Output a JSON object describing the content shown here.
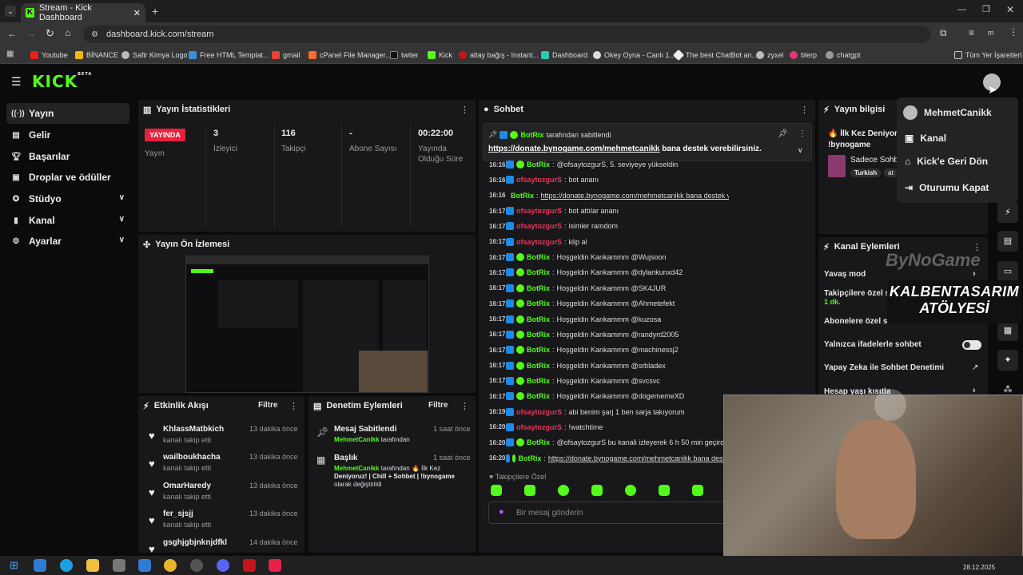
{
  "browser": {
    "tab_title": "Stream - Kick Dashboard",
    "url": "dashboard.kick.com/stream",
    "bookmarks": [
      "Youtube",
      "BİNANCE",
      "Safir Kimya Logo",
      "Free HTML Templat...",
      "gmail",
      "cPanel File Manager...",
      "twiter",
      "Kick",
      "altay bağış - Instant...",
      "Dashboard",
      "Okey Oyna - Canlı 1...",
      "The best ChatBot an...",
      "zyxel",
      "blerp",
      "chatgpt"
    ],
    "all_bookmarks": "Tüm Yer İşaretleri",
    "profile_initial": "m"
  },
  "header": {
    "logo": "KICK",
    "beta": "BETA"
  },
  "sidebar": {
    "items": [
      {
        "label": "Yayın"
      },
      {
        "label": "Gelir"
      },
      {
        "label": "Başarılar"
      },
      {
        "label": "Droplar ve ödüller"
      },
      {
        "label": "Stüdyo"
      },
      {
        "label": "Kanal"
      },
      {
        "label": "Ayarlar"
      }
    ]
  },
  "stats": {
    "title": "Yayın İstatistikleri",
    "live_badge": "YAYINDA",
    "live_label": "Yayın",
    "viewers_value": "3",
    "viewers_label": "İzleyici",
    "followers_value": "116",
    "followers_label": "Takipçi",
    "subs_value": "-",
    "subs_label": "Abone Sayısı",
    "duration_value": "00:22:00",
    "duration_label_1": "Yayında",
    "duration_label_2": "Olduğu Süre"
  },
  "preview": {
    "title": "Yayın Ön İzlemesi"
  },
  "activity": {
    "title": "Etkinlik Akışı",
    "filter": "Filtre",
    "events": [
      {
        "name": "KhlassMatbkich",
        "sub": "kanalı takip etti",
        "time": "13 dakika önce"
      },
      {
        "name": "wailboukhacha",
        "sub": "kanalı takip etti",
        "time": "13 dakika önce"
      },
      {
        "name": "OmarHaredy",
        "sub": "kanalı takip etti",
        "time": "13 dakika önce"
      },
      {
        "name": "fer_sjsjj",
        "sub": "kanalı takip etti",
        "time": "13 dakika önce"
      },
      {
        "name": "gsghjgbjnknjdfkl",
        "sub": "",
        "time": "14 dakika önce"
      }
    ]
  },
  "mod": {
    "title": "Denetim Eylemleri",
    "filter": "Filtre",
    "a1_title": "Mesaj Sabitlendi",
    "a1_user": "MehmetCanikk",
    "a1_rest": "tarafından",
    "a1_time": "1 saat önce",
    "a2_title": "Başlık",
    "a2_user": "MehmetCanikk",
    "a2_rest": "tarafından 🔥 İlk Kez",
    "a2_line2": "Deniyoruz! | Chill + Sohbet | !bynogame",
    "a2_line3": "olarak değiştirildi",
    "a2_time": "1 saat önce"
  },
  "chat": {
    "title": "Sohbet",
    "pinned_by_user": "BotRix",
    "pinned_by_rest": "tarafından sabitlendi",
    "pinned_link": "https://donate.bynogame.com/mehmetcanikk",
    "pinned_rest": "bana destek verebilirsiniz.",
    "messages": [
      {
        "time": "16:16",
        "user": "BotRix",
        "text": "@ofsaytozgurS, 5. seviyeye yükseldin",
        "color": "#53fc18",
        "bot": true
      },
      {
        "time": "16:16",
        "user": "ofsaytozgurS",
        "text": "bot ananı",
        "color": "#e8345a",
        "bot": false
      },
      {
        "time": "16:16",
        "user": "BotRix",
        "text": "https://donate.bynogame.com/mehmetcanikk bana destek verebilirsiniz.",
        "color": "#53fc18",
        "bot": true
      },
      {
        "time": "16:17",
        "user": "ofsaytozgurS",
        "text": "bot attılar ananı",
        "color": "#e8345a",
        "bot": false
      },
      {
        "time": "16:17",
        "user": "ofsaytozgurS",
        "text": "isimler ramdom",
        "color": "#e8345a",
        "bot": false
      },
      {
        "time": "16:17",
        "user": "ofsaytozgurS",
        "text": "klip al",
        "color": "#e8345a",
        "bot": false
      },
      {
        "time": "16:17",
        "user": "BotRix",
        "text": "Hoşgeldin Kankammm @Wujsoon",
        "color": "#53fc18",
        "bot": true
      },
      {
        "time": "16:17",
        "user": "BotRix",
        "text": "Hoşgeldin Kankammm @dylankunxd42",
        "color": "#53fc18",
        "bot": true
      },
      {
        "time": "16:17",
        "user": "BotRix",
        "text": "Hoşgeldin Kankammm @SK4JUR",
        "color": "#53fc18",
        "bot": true
      },
      {
        "time": "16:17",
        "user": "BotRix",
        "text": "Hoşgeldin Kankammm @Ahmetefekt",
        "color": "#53fc18",
        "bot": true
      },
      {
        "time": "16:17",
        "user": "BotRix",
        "text": "Hoşgeldin Kankammm @kuzosa",
        "color": "#53fc18",
        "bot": true
      },
      {
        "time": "16:17",
        "user": "BotRix",
        "text": "Hoşgeldin Kankammm @randyrd2005",
        "color": "#53fc18",
        "bot": true
      },
      {
        "time": "16:17",
        "user": "BotRix",
        "text": "Hoşgeldin Kankammm @machinessj2",
        "color": "#53fc18",
        "bot": true
      },
      {
        "time": "16:17",
        "user": "BotRix",
        "text": "Hoşgeldin Kankammm @srbladex",
        "color": "#53fc18",
        "bot": true
      },
      {
        "time": "16:17",
        "user": "BotRix",
        "text": "Hoşgeldin Kankammm @svcsvc",
        "color": "#53fc18",
        "bot": true
      },
      {
        "time": "16:17",
        "user": "BotRix",
        "text": "Hoşgeldin Kankammm @dogememeXD",
        "color": "#53fc18",
        "bot": true
      },
      {
        "time": "16:19",
        "user": "ofsaytozgurS",
        "text": "abi benim şarj 1 ben sarja takıyorum",
        "color": "#e8345a",
        "bot": false
      },
      {
        "time": "16:20",
        "user": "ofsaytozgurS",
        "text": "!watchtime",
        "color": "#e8345a",
        "bot": false
      },
      {
        "time": "16:20",
        "user": "BotRix",
        "text": "@ofsaytozgurS bu kanali izleyerek 6 h 50 min geçirdi.",
        "color": "#53fc18",
        "bot": true
      },
      {
        "time": "16:20",
        "user": "BotRix",
        "text": "https://donate.bynogame.com/mehmetcanikk bana deste",
        "color": "#53fc18",
        "bot": true
      }
    ],
    "emote_section": "Takipçilere Özel",
    "input_placeholder": "Bir mesaj gönderin"
  },
  "info": {
    "title": "Yayın bilgisi",
    "stream_title_1": "🔥 İlk Kez Deniyoru",
    "stream_title_2": "!bynogame",
    "category": "Sadece Sohb",
    "tag1": "Turkish",
    "tag2": "at"
  },
  "channel_actions": {
    "title": "Kanal Eylemleri",
    "slow_mode": "Yavaş mod",
    "followers_only": "Takipçilere özel s",
    "followers_only_value": "1 dk.",
    "subs_only": "Abonelere özel s",
    "emote_only": "Yalnızca ifadelerle sohbet",
    "ai_moderation": "Yapay Zeka ile Sohbet Denetimi",
    "account_age": "Hesap yaşı kısıtla"
  },
  "dropdown": {
    "user": "MehmetCanikk",
    "channel": "Kanal",
    "back_to_kick": "Kick'e Geri Dön",
    "logout": "Oturumu Kapat"
  },
  "overlay": {
    "brand": "ByNoGame",
    "sign_line_1": "KALBENTASARIM",
    "sign_line_2": "ATÖLYESİ"
  },
  "taskbar": {
    "date": "28.12.2025"
  },
  "colors": {
    "accent": "#53fc18",
    "live": "#e8213c",
    "panel": "#18181b"
  }
}
